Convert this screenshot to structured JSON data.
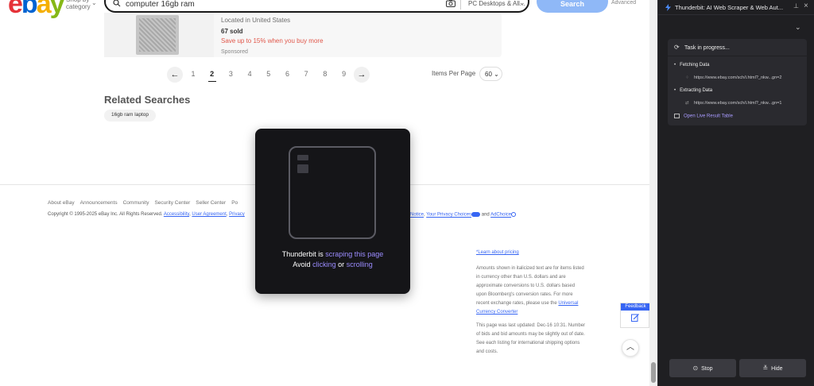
{
  "ebay": {
    "logo_letters": [
      {
        "ch": "e",
        "color": "#e53238"
      },
      {
        "ch": "b",
        "color": "#0064d2"
      },
      {
        "ch": "a",
        "color": "#f5af02"
      },
      {
        "ch": "y",
        "color": "#86b817"
      }
    ],
    "shop_by_category": "Shop by category",
    "search": {
      "value": "computer 16gb ram",
      "category": "PC Desktops & All...",
      "button": "Search",
      "advanced": "Advanced"
    },
    "listing": {
      "location": "Located in United States",
      "sold": "67 sold",
      "promo": "Save up to 15% when you buy more",
      "sponsored": "Sponsored"
    },
    "pagination": {
      "prev_icon": "arrow-left-icon",
      "next_icon": "arrow-right-icon",
      "pages": [
        "1",
        "2",
        "3",
        "4",
        "5",
        "6",
        "7",
        "8",
        "9"
      ],
      "current": "2",
      "items_per_page_label": "Items Per Page",
      "items_per_page_value": "60"
    },
    "related": {
      "title": "Related Searches",
      "chips": [
        "16gb ram laptop"
      ]
    },
    "footer": {
      "links": [
        "About eBay",
        "Announcements",
        "Community",
        "Security Center",
        "Seller Center",
        "Po"
      ],
      "copyright": "Copyright © 1995-2025 eBay Inc. All Rights Reserved.",
      "legal_links": [
        "Accessibility",
        "User Agreement",
        "Privacy"
      ],
      "legal_right_links": [
        "Notice",
        "Your Privacy Choices"
      ],
      "legal_and": "and",
      "adchoice": "AdChoice"
    },
    "disclaimers": {
      "pricing_link": "*Learn about pricing",
      "para1_lines": [
        "Amounts shown in italicized text are for items listed",
        "in currency other than U.S. dollars and are",
        "approximate conversions to U.S. dollars based",
        "upon Bloomberg's conversion rates. For more",
        "recent exchange rates, please use the"
      ],
      "converter_link": "Universal",
      "converter_link2": "Currency Converter",
      "para2_lines": [
        "This page was last updated: Dec-16 10:31. Number",
        "of bids and bid amounts may be slightly out of date.",
        "See each listing for international shipping options",
        "and costs."
      ]
    },
    "feedback": "Feedback"
  },
  "overlay": {
    "line1_prefix": "Thunderbit is",
    "line1_highlight": "scraping this page",
    "line2_prefix": "Avoid",
    "line2_hl1": "clicking",
    "line2_mid": "or",
    "line2_hl2": "scrolling"
  },
  "panel": {
    "title": "Thunderbit: AI Web Scraper & Web Aut...",
    "task_status": "Task in progress...",
    "steps": [
      {
        "label": "Fetching Data",
        "url": "https://www.ebay.com/sch/i.html?_nkw...gn=2"
      },
      {
        "label": "Extracting Data",
        "url": "https://www.ebay.com/sch/i.html?_nkw...gn=1"
      }
    ],
    "live_table": "Open Live Result Table",
    "stop": "Stop",
    "hide": "Hide"
  }
}
